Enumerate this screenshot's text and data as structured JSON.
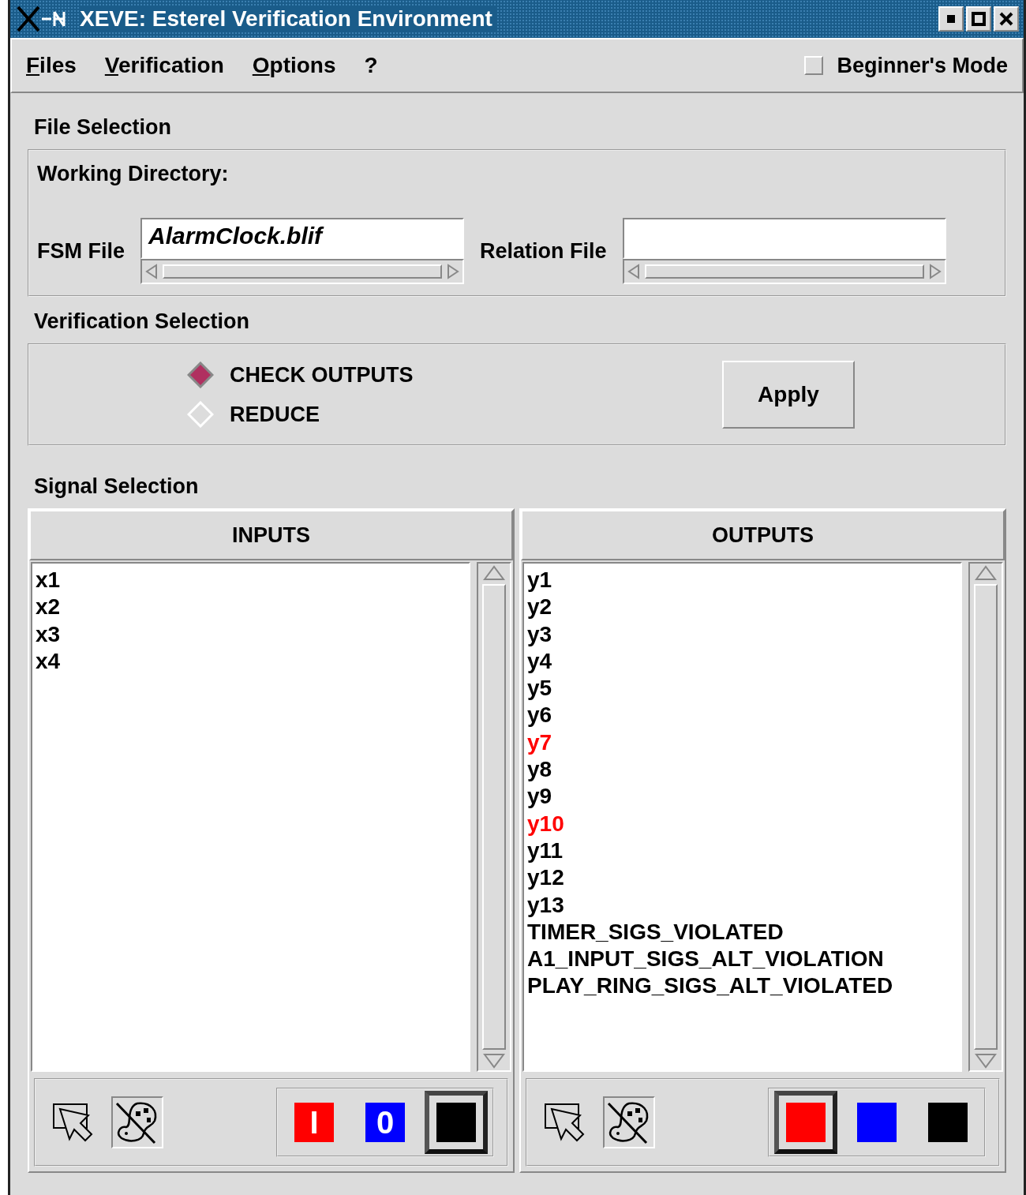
{
  "window": {
    "title": "XEVE: Esterel Verification Environment"
  },
  "menu": [
    {
      "label": "Files"
    },
    {
      "label": "Verification"
    },
    {
      "label": "Options"
    },
    {
      "label": "?"
    }
  ],
  "beginners_mode": {
    "label": "Beginner's Mode",
    "checked": false
  },
  "file_selection": {
    "title": "File Selection",
    "working_directory_label": "Working Directory:",
    "fsm_label": "FSM File",
    "fsm_value": "AlarmClock.blif",
    "relation_label": "Relation File"
  },
  "verification_selection": {
    "title": "Verification Selection",
    "options": [
      {
        "label": "CHECK OUTPUTS",
        "selected": true
      },
      {
        "label": "REDUCE",
        "selected": false
      }
    ],
    "apply": "Apply"
  },
  "signal_selection": {
    "title": "Signal Selection",
    "panels": [
      {
        "title": "INPUTS",
        "items": [
          {
            "name": "x1",
            "color": "#000000"
          },
          {
            "name": "x2",
            "color": "#000000"
          },
          {
            "name": "x3",
            "color": "#000000"
          },
          {
            "name": "x4",
            "color": "#000000"
          }
        ],
        "palette": [
          {
            "color": "#ff0000",
            "label": "I",
            "selected": false
          },
          {
            "color": "#0000ff",
            "label": "0",
            "selected": false
          },
          {
            "color": "#000000",
            "selected": true
          }
        ]
      },
      {
        "title": "OUTPUTS",
        "items": [
          {
            "name": "y1",
            "color": "#000000"
          },
          {
            "name": "y2",
            "color": "#000000"
          },
          {
            "name": "y3",
            "color": "#000000"
          },
          {
            "name": "y4",
            "color": "#000000"
          },
          {
            "name": "y5",
            "color": "#000000"
          },
          {
            "name": "y6",
            "color": "#000000"
          },
          {
            "name": "y7",
            "color": "#ff0000"
          },
          {
            "name": "y8",
            "color": "#000000"
          },
          {
            "name": "y9",
            "color": "#000000"
          },
          {
            "name": "y10",
            "color": "#ff0000"
          },
          {
            "name": "y11",
            "color": "#000000"
          },
          {
            "name": "y12",
            "color": "#000000"
          },
          {
            "name": "y13",
            "color": "#000000"
          },
          {
            "name": "TIMER_SIGS_VIOLATED",
            "color": "#000000"
          },
          {
            "name": "A1_INPUT_SIGS_ALT_VIOLATION",
            "color": "#000000"
          },
          {
            "name": "PLAY_RING_SIGS_ALT_VIOLATED",
            "color": "#000000"
          }
        ],
        "palette": [
          {
            "color": "#ff0000",
            "selected": true
          },
          {
            "color": "#0000ff",
            "selected": false
          },
          {
            "color": "#000000",
            "selected": false
          }
        ]
      }
    ]
  }
}
